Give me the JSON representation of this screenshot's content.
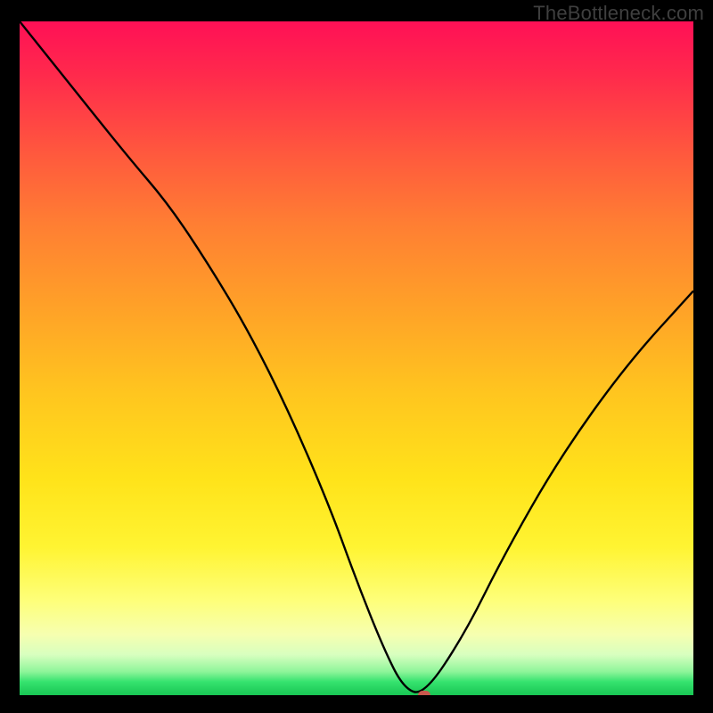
{
  "watermark_text": "TheBottleneck.com",
  "chart_data": {
    "type": "line",
    "title": "",
    "xlabel": "",
    "ylabel": "",
    "xlim": [
      0,
      100
    ],
    "ylim": [
      0,
      100
    ],
    "grid": false,
    "legend": false,
    "series": [
      {
        "name": "bottleneck-curve",
        "x": [
          0,
          8,
          16,
          22,
          28,
          34,
          40,
          46,
          50,
          54,
          57,
          60,
          66,
          72,
          80,
          90,
          100
        ],
        "values": [
          100,
          90,
          80,
          73,
          64,
          54,
          42,
          28,
          17,
          7,
          1,
          0,
          9,
          21,
          35,
          49,
          60
        ]
      }
    ],
    "flat_minimum": {
      "x_start": 57,
      "x_end": 60,
      "value": 0
    },
    "marker": {
      "x": 60,
      "y": 0,
      "color": "#c9584d"
    },
    "background_gradient_description": "vertical performance heat gradient: red (high bottleneck) at top through orange and yellow to green (optimal) at bottom"
  },
  "colors": {
    "page_background": "#000000",
    "curve_stroke": "#000000",
    "watermark": "#3f3f3f",
    "marker": "#c9584d"
  }
}
